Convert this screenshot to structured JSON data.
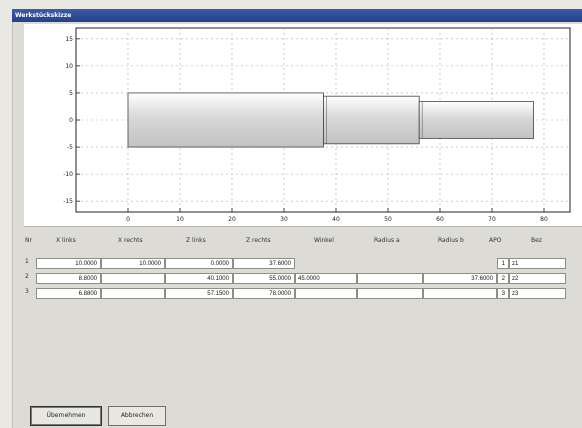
{
  "window": {
    "title": "Werkstückskizze"
  },
  "plot": {
    "y_ticks": [
      "15",
      "10",
      "5",
      "0",
      "-5",
      "-10",
      "-15"
    ],
    "x_ticks": [
      "0",
      "10",
      "20",
      "30",
      "40",
      "50",
      "60",
      "70",
      "80"
    ],
    "xlim": [
      -10,
      85
    ],
    "ylim": [
      -17,
      17
    ],
    "segments": [
      {
        "x_left": 0,
        "x_right": 37.6,
        "radius": 5
      },
      {
        "x_left": 37.6,
        "x_right": 56.0,
        "radius": 4.4
      },
      {
        "x_left": 56.0,
        "x_right": 78.0,
        "radius": 3.4
      }
    ]
  },
  "table": {
    "headers": [
      "Nr",
      "X links",
      "X rechts",
      "Z links",
      "Z rechts",
      "Winkel",
      "Radius a",
      "Radius b",
      "APO",
      "Bez"
    ],
    "rows": [
      {
        "nr": "1",
        "x_links": "10.0000",
        "x_rechts": "10.0000",
        "z_links": "0.0000",
        "z_rechts": "37.6000",
        "winkel": "",
        "radius_a": "",
        "radius_b": "",
        "apo": "1",
        "bez": "z1"
      },
      {
        "nr": "2",
        "x_links": "8.8000",
        "x_rechts": "",
        "z_links": "40.1000",
        "z_rechts": "55.0000",
        "winkel": "45.0000",
        "radius_a": "",
        "radius_b": "37.6000",
        "apo": "2",
        "bez": "z2"
      },
      {
        "nr": "3",
        "x_links": "6.8800",
        "x_rechts": "",
        "z_links": "57.1500",
        "z_rechts": "78.0000",
        "winkel": "",
        "radius_a": "",
        "radius_b": "",
        "apo": "3",
        "bez": "z3"
      }
    ]
  },
  "buttons": {
    "accept": "Übernehmen",
    "cancel": "Abbrechen"
  }
}
